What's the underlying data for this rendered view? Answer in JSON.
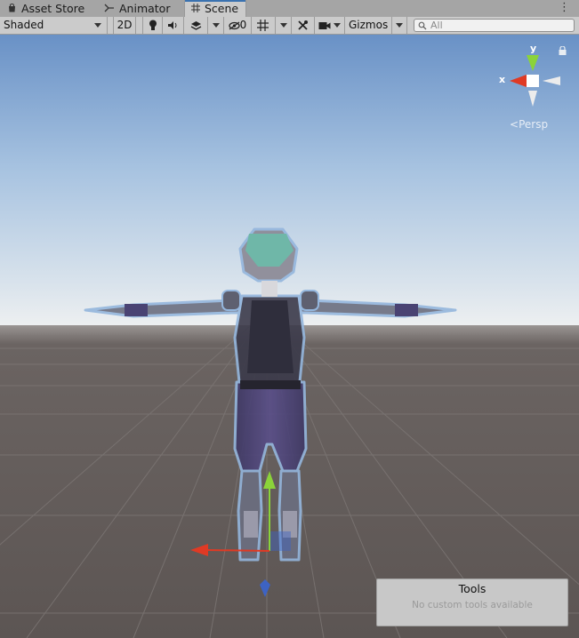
{
  "tabs": [
    {
      "label": "Asset Store",
      "icon": "shopping-bag-icon"
    },
    {
      "label": "Animator",
      "icon": "animator-icon"
    },
    {
      "label": "Scene",
      "icon": "grid-icon",
      "active": true
    }
  ],
  "toolbar": {
    "draw_mode": "Shaded",
    "mode_2d": "2D",
    "hidden_count": "0",
    "gizmos": "Gizmos",
    "search_placeholder": "All"
  },
  "scene": {
    "projection": "Persp",
    "axis_x": "x",
    "axis_y": "y"
  },
  "tools_overlay": {
    "title": "Tools",
    "subtitle": "No custom tools available"
  },
  "colors": {
    "sky_top": "#6e95c8",
    "sky_horizon": "#e9ecef",
    "ground": "#5f5856",
    "axis_x": "#e03a24",
    "axis_y": "#8bd33a",
    "axis_z": "#3d63c4",
    "character_outline": "#94b6dd",
    "character_armor": "#6b6e80",
    "character_suit": "#4a4373",
    "character_visor": "#6fb7a8"
  }
}
